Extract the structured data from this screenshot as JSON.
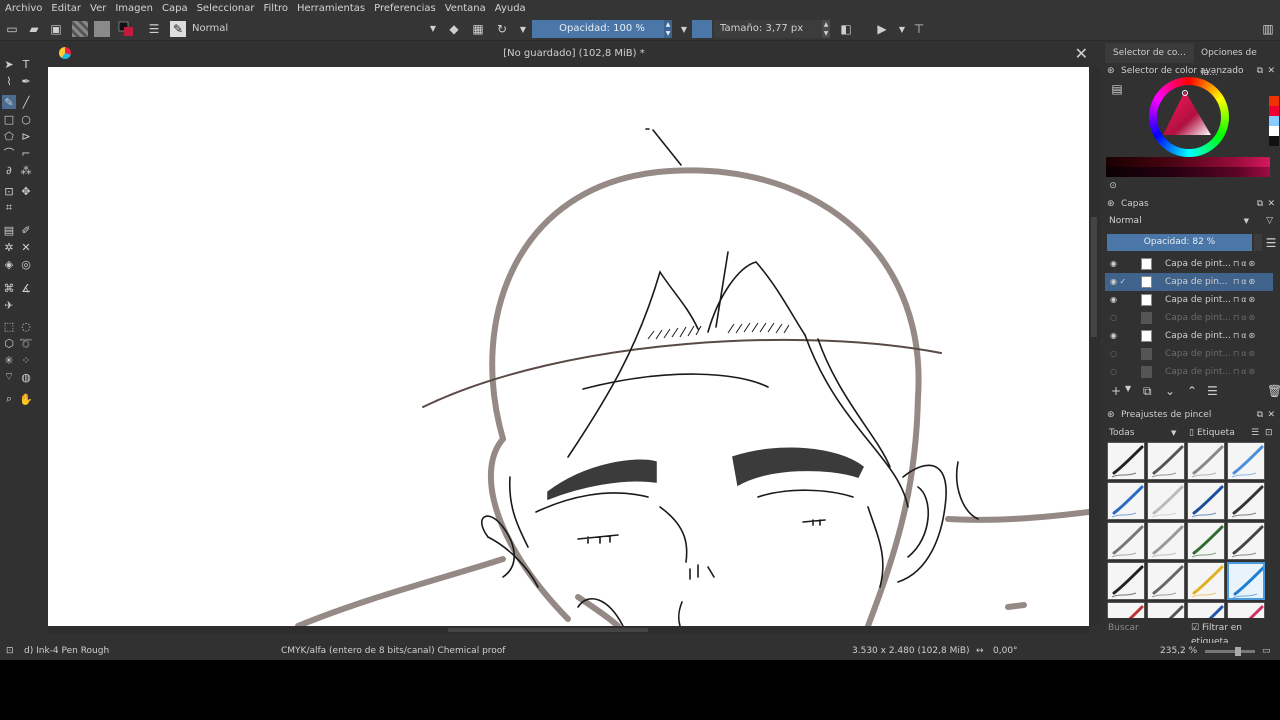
{
  "menu": [
    "Archivo",
    "Editar",
    "Ver",
    "Imagen",
    "Capa",
    "Seleccionar",
    "Filtro",
    "Herramientas",
    "Preferencias",
    "Ventana",
    "Ayuda"
  ],
  "toolbar": {
    "blend_mode": "Normal",
    "opacity_label": "Opacidad: 100 %",
    "size_label": "Tamaño: 3,77 px"
  },
  "document": {
    "title": "[No guardado]  (102,8 MiB) *"
  },
  "docker": {
    "tabs": [
      "Selector de co...",
      "Opciones de la..."
    ],
    "color_panel_title": "Selector de color avanzado",
    "layers_panel_title": "Capas",
    "layers_blend": "Normal",
    "layers_opacity": "Opacidad:  82 %",
    "layers": [
      {
        "name": "Capa de pint...",
        "visible": true,
        "active": false,
        "dim": false
      },
      {
        "name": "Capa de pin...",
        "visible": true,
        "active": true,
        "dim": false
      },
      {
        "name": "Capa de pint...",
        "visible": true,
        "active": false,
        "dim": false
      },
      {
        "name": "Capa de pint...",
        "visible": false,
        "active": false,
        "dim": true
      },
      {
        "name": "Capa de pint...",
        "visible": true,
        "active": false,
        "dim": false
      },
      {
        "name": "Capa de pint...",
        "visible": false,
        "active": false,
        "dim": true
      },
      {
        "name": "Capa de pint...",
        "visible": false,
        "active": false,
        "dim": true
      }
    ],
    "brush_panel_title": "Preajustes de pincel",
    "brush_filter": "Todas",
    "brush_tag": "Etiqueta",
    "brush_search_placeholder": "Buscar",
    "brush_filter_tag": "Filtrar en etiqueta"
  },
  "status": {
    "brush_name": "d) Ink-4 Pen Rough",
    "color_space": "CMYK/alfa (entero de 8 bits/canal)  Chemical proof",
    "image_size": "3.530 x 2.480 (102,8 MiB)",
    "rotation": "0,00°",
    "zoom": "235,2 %"
  },
  "colors": {
    "accent": "#4b77a8",
    "sketch_stroke": "#8a7d79",
    "ink": "#1a1a1a"
  }
}
